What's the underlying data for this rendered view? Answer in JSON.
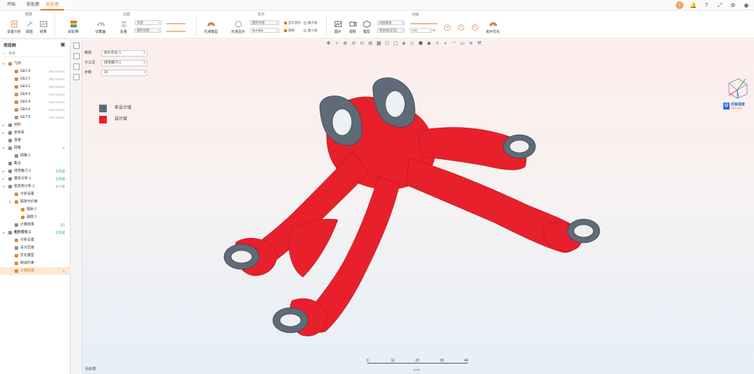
{
  "tabs": [
    "开始",
    "前处理",
    "后处理"
  ],
  "active_tab": 2,
  "ribbon": {
    "groups": [
      "数据",
      "云图",
      "显示",
      "动画"
    ],
    "buttons": {
      "report": "设置分析",
      "probe": "探值",
      "result": "结果",
      "legend": "彩虹带",
      "section": "切截面",
      "vector": "矢量",
      "display_model": "光滑模型",
      "smooth_display": "光滑显示",
      "image": "图片",
      "video": "视频",
      "mode": "模型",
      "topo_opt": "拓扑优化"
    },
    "dropdowns": {
      "yunti1": "云图",
      "yunti2": "面积云图",
      "render_mode": "面积云图",
      "display_value": "314.661",
      "anim_mode": "动画缩放",
      "anim_dir": "等值线(正向)",
      "anim_percent": "100"
    },
    "checkboxes": {
      "show_def": "显示变形",
      "max": "最大值",
      "legend": "图例",
      "min": "最小值"
    },
    "percent_unit": "%"
  },
  "left_panel": {
    "title": "项目树",
    "search_placeholder": "搜索",
    "tree": [
      {
        "label": "几何",
        "level": 0,
        "arrow": "▾",
        "color": "#d98a3a"
      },
      {
        "label": "GE1-0",
        "level": 1,
        "meta": "30CrMnSiA",
        "color": "#c98b4e"
      },
      {
        "label": "GE2-1",
        "level": 1,
        "meta": "30CrMnSiA",
        "color": "#c98b4e"
      },
      {
        "label": "GE3-2",
        "level": 1,
        "meta": "30CrMnSiA",
        "color": "#c98b4e"
      },
      {
        "label": "GE4-3",
        "level": 1,
        "meta": "30CrMnSiA",
        "color": "#c98b4e"
      },
      {
        "label": "GE5-4",
        "level": 1,
        "meta": "30CrMnSiA",
        "color": "#c98b4e"
      },
      {
        "label": "GE6-5",
        "level": 1,
        "meta": "30CrMnSiA",
        "color": "#c98b4e"
      },
      {
        "label": "GE7-6",
        "level": 1,
        "meta": "30CrMnSiA",
        "color": "#c98b4e"
      },
      {
        "label": "材料",
        "level": 0,
        "arrow": "▸",
        "color": "#888"
      },
      {
        "label": "坐标系",
        "level": 0,
        "arrow": "▸",
        "color": "#888"
      },
      {
        "label": "连接",
        "level": 0,
        "arrow": "",
        "color": "#888"
      },
      {
        "label": "网格",
        "level": 0,
        "arrow": "▾",
        "color": "#7a8fa6",
        "icon_right": "↻"
      },
      {
        "label": "网格-1",
        "level": 1,
        "color": "#7a8fa6"
      },
      {
        "label": "集合",
        "level": 0,
        "arrow": "",
        "color": "#888"
      },
      {
        "label": "线性静力-1",
        "level": 0,
        "arrow": "▸",
        "color": "#888",
        "status": "已完成",
        "status_color": "#3aa55a"
      },
      {
        "label": "模态分析-1",
        "level": 0,
        "arrow": "▸",
        "color": "#888",
        "status": "已完成",
        "status_color": "#3aa55a"
      },
      {
        "label": "稳态热分析-1",
        "level": 0,
        "arrow": "▾",
        "color": "#888",
        "status": "未计算",
        "status_color": "#999"
      },
      {
        "label": "分析设置",
        "level": 1,
        "color": "#d98a3a"
      },
      {
        "label": "载荷与约束",
        "level": 1,
        "arrow": "▾",
        "color": "#d98a3a"
      },
      {
        "label": "辐射-1",
        "level": 2,
        "color": "#d98a3a"
      },
      {
        "label": "温度-1",
        "level": 2,
        "color": "#d98a3a"
      },
      {
        "label": "计算结果",
        "level": 1,
        "color": "#888",
        "status": "[空]",
        "status_color": "#999"
      },
      {
        "label": "拓扑优化-1",
        "level": 0,
        "arrow": "▾",
        "color": "#888",
        "status": "已完成",
        "status_color": "#3aa55a",
        "bold": true
      },
      {
        "label": "分析设置",
        "level": 1,
        "color": "#d98a3a"
      },
      {
        "label": "设计区域",
        "level": 1,
        "color": "#888"
      },
      {
        "label": "优化模型",
        "level": 1,
        "color": "#d98a3a"
      },
      {
        "label": "制造约束",
        "level": 1,
        "color": "#d98a3a"
      },
      {
        "label": "计算结果",
        "level": 1,
        "color": "#d98a3a",
        "selected": true,
        "icon_right": "↻"
      }
    ]
  },
  "viewport": {
    "fields": [
      {
        "label": "算例",
        "value": "拓扑优化-1"
      },
      {
        "label": "子工况",
        "value": "线性静力-1"
      },
      {
        "label": "步数",
        "value": "20"
      }
    ],
    "legend": [
      {
        "label": "非设计域",
        "color": "#5f6b77"
      },
      {
        "label": "设计域",
        "color": "#e8202c"
      }
    ],
    "scale_ticks": [
      "0",
      "11",
      "22",
      "33",
      "44"
    ],
    "scale_unit": "(mm)",
    "brand_name": "优解速度",
    "brand_sub": "OptFuture",
    "bottom_tab": "后处理"
  },
  "colors": {
    "accent": "#e8731a",
    "design": "#e8202c",
    "non_design": "#5f6b77"
  }
}
